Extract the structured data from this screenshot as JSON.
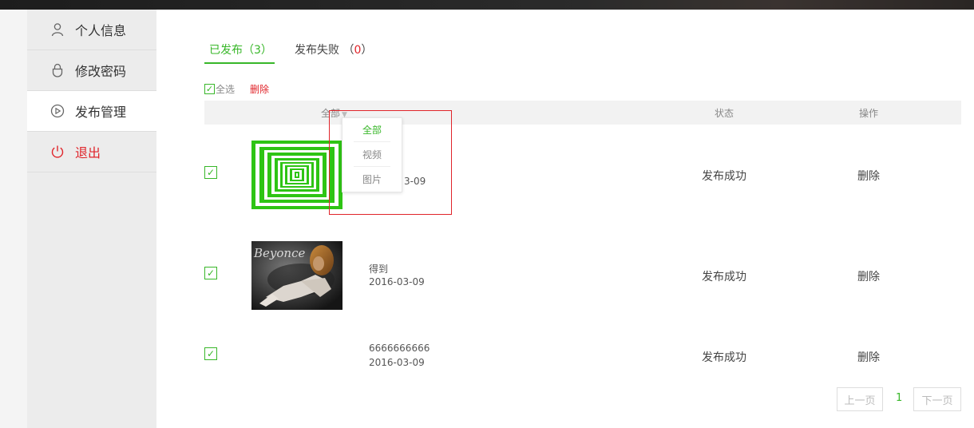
{
  "sidebar": {
    "items": [
      {
        "label": "个人信息",
        "icon": "user-icon"
      },
      {
        "label": "修改密码",
        "icon": "lock-icon"
      },
      {
        "label": "发布管理",
        "icon": "play-icon",
        "active": true
      },
      {
        "label": "退出",
        "icon": "power-icon",
        "color": "#e0242a"
      }
    ]
  },
  "tabs": {
    "published": {
      "label": "已发布（",
      "count": "3",
      "close": "）"
    },
    "failed": {
      "label": "发布失败 （",
      "count": "0",
      "close": "）"
    }
  },
  "toolbar": {
    "select_all": "全选",
    "delete": "删除"
  },
  "table": {
    "header": {
      "all": "全部",
      "status": "状态",
      "operation": "操作"
    },
    "rows": [
      {
        "title": "",
        "date_visible": "3-09",
        "status": "发布成功",
        "op": "删除",
        "thumb": "green-concentric-squares"
      },
      {
        "title": "得到",
        "date": "2016-03-09",
        "status": "发布成功",
        "op": "删除",
        "thumb": "photo-beyonce",
        "thumb_text": "Beyonce"
      },
      {
        "title": "6666666666",
        "date": "2016-03-09",
        "status": "发布成功",
        "op": "删除",
        "thumb": "none"
      }
    ]
  },
  "dropdown": {
    "options": [
      "全部",
      "视频",
      "图片"
    ],
    "selected": "全部"
  },
  "pager": {
    "prev": "上一页",
    "current": "1",
    "next": "下一页"
  },
  "colors": {
    "accent": "#38b729",
    "danger": "#e0242a"
  }
}
